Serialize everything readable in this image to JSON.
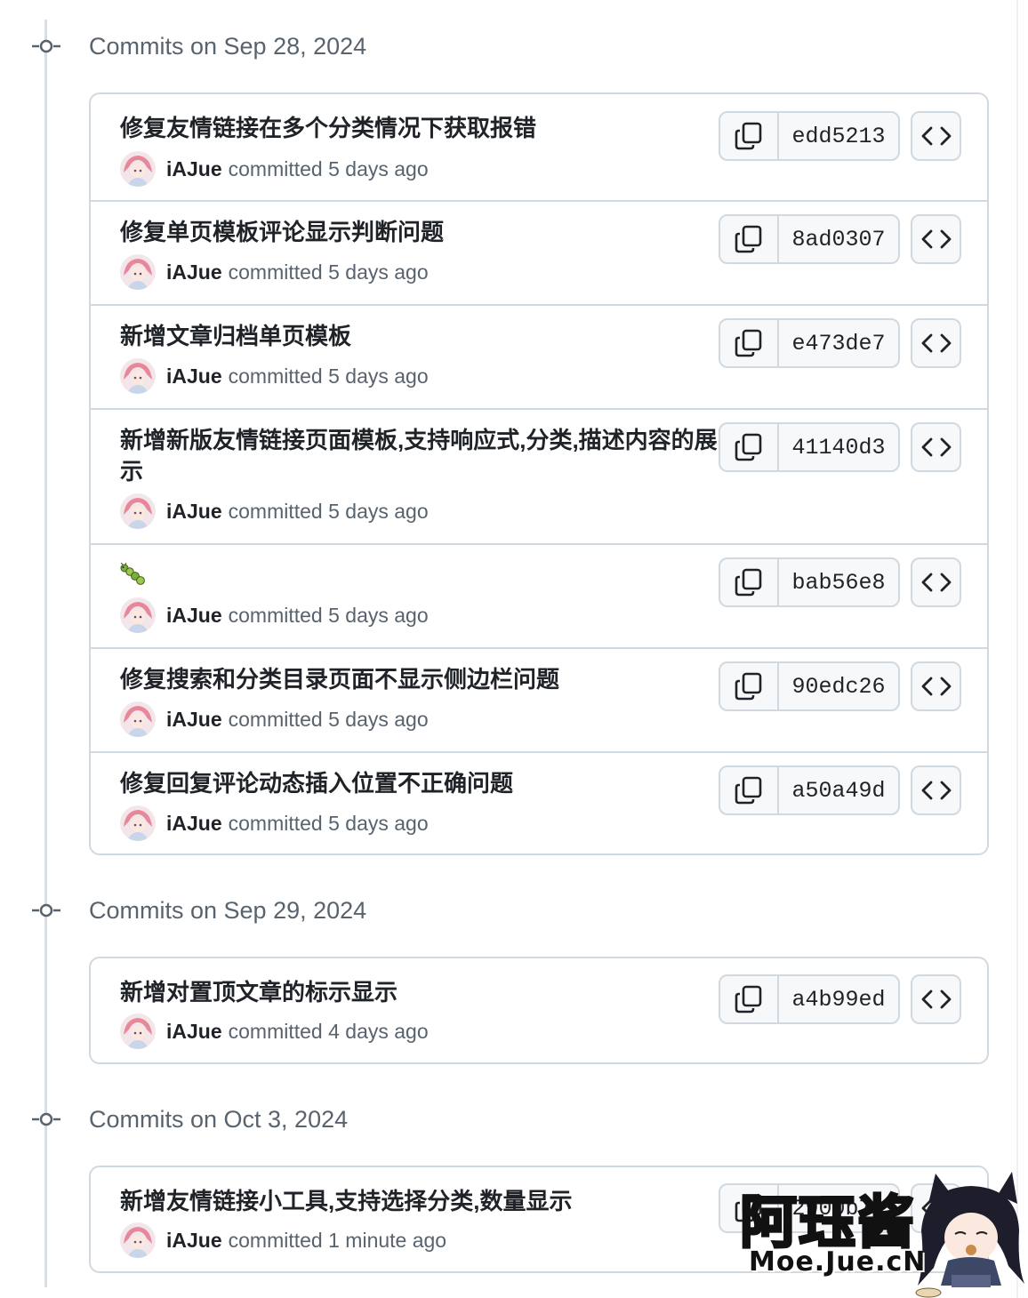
{
  "days": [
    {
      "title": "Commits on Sep 28, 2024",
      "commits": [
        {
          "message": "修复友情链接在多个分类情况下获取报错",
          "author": "iAJue",
          "committed": "committed 5 days ago",
          "sha": "edd5213"
        },
        {
          "message": "修复单页模板评论显示判断问题",
          "author": "iAJue",
          "committed": "committed 5 days ago",
          "sha": "8ad0307"
        },
        {
          "message": "新增文章归档单页模板",
          "author": "iAJue",
          "committed": "committed 5 days ago",
          "sha": "e473de7"
        },
        {
          "message": "新增新版友情链接页面模板,支持响应式,分类,描述内容的展示",
          "author": "iAJue",
          "committed": "committed 5 days ago",
          "sha": "41140d3"
        },
        {
          "message": "🐛",
          "author": "iAJue",
          "committed": "committed 5 days ago",
          "sha": "bab56e8"
        },
        {
          "message": "修复搜索和分类目录页面不显示侧边栏问题",
          "author": "iAJue",
          "committed": "committed 5 days ago",
          "sha": "90edc26"
        },
        {
          "message": "修复回复评论动态插入位置不正确问题",
          "author": "iAJue",
          "committed": "committed 5 days ago",
          "sha": "a50a49d"
        }
      ]
    },
    {
      "title": "Commits on Sep 29, 2024",
      "commits": [
        {
          "message": "新增对置顶文章的标示显示",
          "author": "iAJue",
          "committed": "committed 4 days ago",
          "sha": "a4b99ed"
        }
      ]
    },
    {
      "title": "Commits on Oct 3, 2024",
      "commits": [
        {
          "message": "新增友情链接小工具,支持选择分类,数量显示",
          "author": "iAJue",
          "committed": "committed 1 minute ago",
          "sha": "2900b7a"
        }
      ]
    }
  ],
  "watermark": {
    "text": "阿珏酱",
    "sub": "Moe.Jue.cN"
  },
  "colors": {
    "border": "#d1d9e0",
    "muted": "#59636e",
    "text": "#1f2328",
    "button_bg": "#f6f8fa"
  },
  "icons": {
    "copy": "copy-icon",
    "browse": "code-icon",
    "node": "git-commit-icon"
  }
}
